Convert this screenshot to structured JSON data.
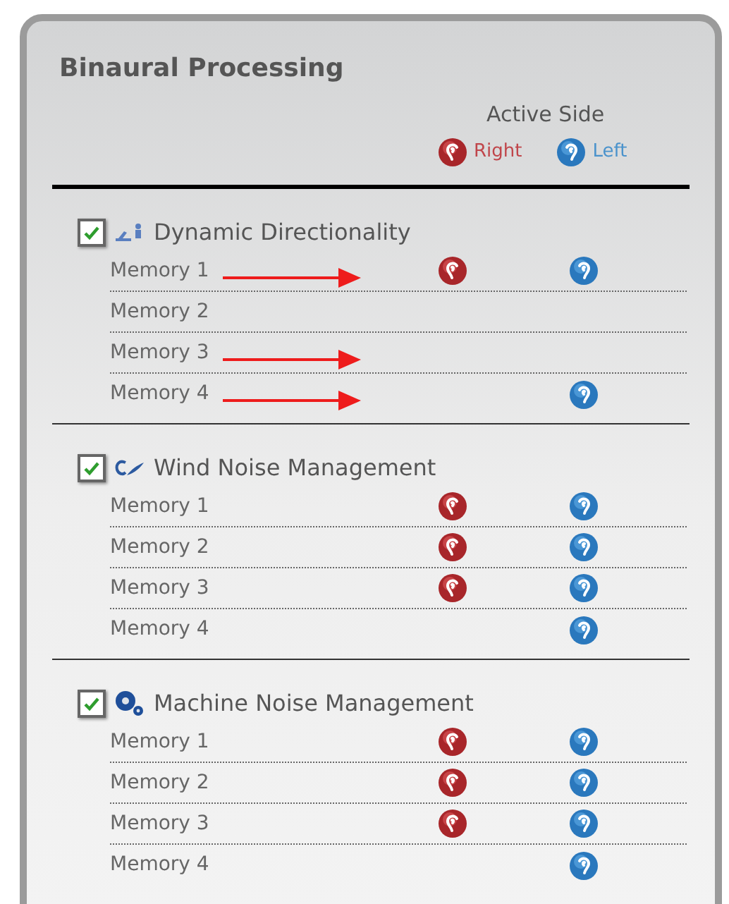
{
  "title": "Binaural Processing",
  "active_side": {
    "heading": "Active Side",
    "legend": [
      {
        "kind": "right",
        "label": "Right"
      },
      {
        "kind": "left",
        "label": "Left"
      }
    ]
  },
  "sections": [
    {
      "kind": "directionality",
      "label": "Dynamic Directionality",
      "checked": true,
      "memories": [
        {
          "label": "Memory 1",
          "right": true,
          "left": true,
          "annotation_arrow": true
        },
        {
          "label": "Memory 2",
          "right": false,
          "left": false,
          "annotation_arrow": false
        },
        {
          "label": "Memory 3",
          "right": false,
          "left": false,
          "annotation_arrow": true
        },
        {
          "label": "Memory 4",
          "right": false,
          "left": true,
          "annotation_arrow": true
        }
      ]
    },
    {
      "kind": "wind",
      "label": "Wind Noise Management",
      "checked": true,
      "memories": [
        {
          "label": "Memory 1",
          "right": true,
          "left": true,
          "annotation_arrow": false
        },
        {
          "label": "Memory 2",
          "right": true,
          "left": true,
          "annotation_arrow": false
        },
        {
          "label": "Memory 3",
          "right": true,
          "left": true,
          "annotation_arrow": false
        },
        {
          "label": "Memory 4",
          "right": false,
          "left": true,
          "annotation_arrow": false
        }
      ]
    },
    {
      "kind": "machine",
      "label": "Machine Noise Management",
      "checked": true,
      "memories": [
        {
          "label": "Memory 1",
          "right": true,
          "left": true,
          "annotation_arrow": false
        },
        {
          "label": "Memory 2",
          "right": true,
          "left": true,
          "annotation_arrow": false
        },
        {
          "label": "Memory 3",
          "right": true,
          "left": true,
          "annotation_arrow": false
        },
        {
          "label": "Memory 4",
          "right": false,
          "left": true,
          "annotation_arrow": false
        }
      ]
    }
  ]
}
